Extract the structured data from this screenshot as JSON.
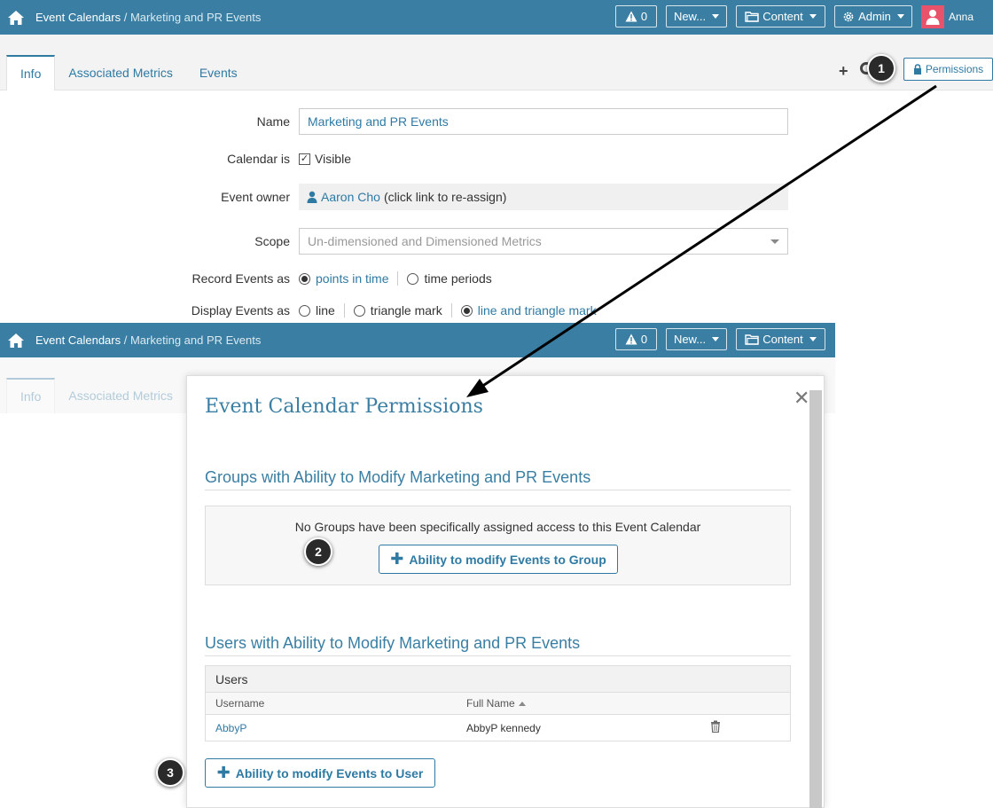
{
  "nav": {
    "breadcrumb_root": "Event Calendars",
    "breadcrumb_sep": " / ",
    "breadcrumb_current": "Marketing and PR Events",
    "alerts_count": "0",
    "new_label": "New...",
    "content_label": "Content",
    "admin_label": "Admin",
    "user_name": "Anna"
  },
  "tabs": {
    "info": "Info",
    "metrics": "Associated Metrics",
    "events": "Events"
  },
  "toolbar": {
    "permissions_label": "Permissions"
  },
  "form": {
    "name_label": "Name",
    "name_value": "Marketing and PR Events",
    "calendar_label": "Calendar is",
    "visible_label": "Visible",
    "owner_label": "Event owner",
    "owner_name": "Aaron Cho",
    "owner_hint": "(click link to re-assign)",
    "scope_label": "Scope",
    "scope_value": "Un-dimensioned and Dimensioned Metrics",
    "record_label": "Record Events as",
    "record_opt1": "points in time",
    "record_opt2": "time periods",
    "display_label": "Display Events as",
    "display_opt1": "line",
    "display_opt2": "triangle mark",
    "display_opt3": "line and triangle mark"
  },
  "modal": {
    "title": "Event Calendar Permissions",
    "groups_heading": "Groups with Ability to Modify Marketing and PR Events",
    "groups_empty": "No Groups have been specifically assigned access to this Event Calendar",
    "add_group_button": "Ability to modify Events to Group",
    "users_heading": "Users with Ability to Modify Marketing and PR Events",
    "users_table": {
      "title": "Users",
      "col_username": "Username",
      "col_fullname": "Full Name",
      "rows": [
        {
          "username": "AbbyP",
          "fullname": "AbbyP kennedy"
        }
      ]
    },
    "add_user_button": "Ability to modify Events to User"
  },
  "steps": {
    "s1": "1",
    "s2": "2",
    "s3": "3"
  }
}
